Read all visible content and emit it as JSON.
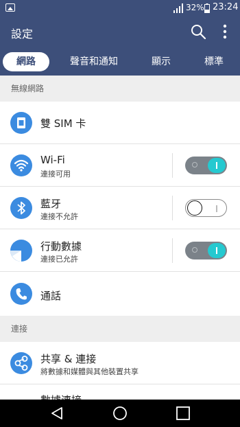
{
  "status_bar": {
    "battery_percent": "32%",
    "time": "23:24",
    "icons": [
      "image-icon",
      "signal-icon",
      "battery-icon"
    ]
  },
  "app_bar": {
    "title": "設定",
    "icons": [
      "search-icon",
      "more-vert-icon"
    ]
  },
  "tabs": [
    {
      "label": "網路",
      "active": true
    },
    {
      "label": "聲音和通知",
      "active": false
    },
    {
      "label": "顯示",
      "active": false
    },
    {
      "label": "標準",
      "active": false
    }
  ],
  "sections": [
    {
      "header": "無線網路"
    },
    {
      "header": "連接"
    }
  ],
  "items": {
    "dual_sim": {
      "label": "雙 SIM 卡",
      "icon": "sim-card-icon"
    },
    "wifi": {
      "label": "Wi-Fi",
      "sub": "連接可用",
      "icon": "wifi-icon",
      "toggle": "on"
    },
    "bluetooth": {
      "label": "藍牙",
      "sub": "連接不允許",
      "icon": "bluetooth-icon",
      "toggle": "off"
    },
    "mobile_data": {
      "label": "行動數據",
      "sub": "連接已允許",
      "icon": "mobile-data-icon",
      "toggle": "on"
    },
    "call": {
      "label": "通話",
      "icon": "phone-icon"
    },
    "share": {
      "label": "共享 & 連接",
      "sub": "將數據和媒體與其他裝置共享",
      "icon": "share-icon"
    },
    "tethering": {
      "label": "數據連接"
    }
  },
  "nav_bar": {
    "icons": [
      "back-icon",
      "home-icon",
      "recents-icon"
    ]
  },
  "colors": {
    "app_bar": "#3d4f7a",
    "accent": "#25c9d0",
    "icon_blue": "#3b8be0"
  }
}
